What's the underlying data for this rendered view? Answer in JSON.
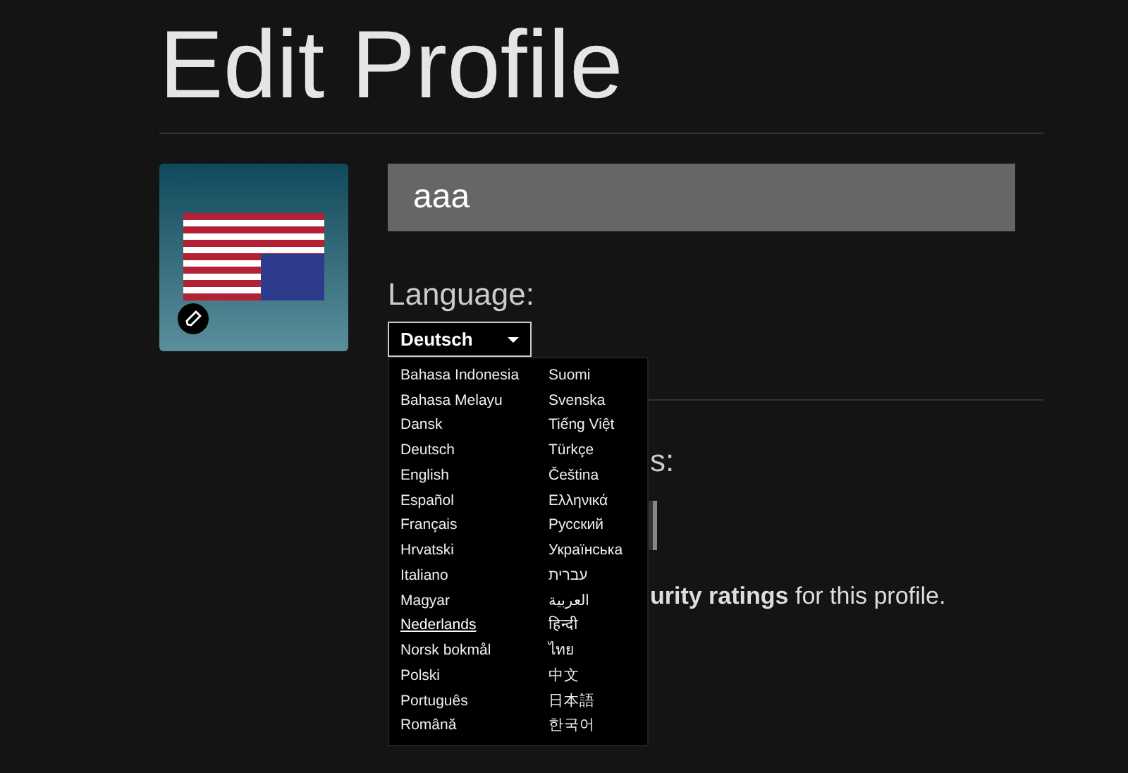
{
  "title": "Edit Profile",
  "profile": {
    "name": "aaa"
  },
  "language": {
    "label": "Language:",
    "value": "Deutsch",
    "expanded": true,
    "options": [
      {
        "label": "Bahasa Indonesia",
        "hovered": false
      },
      {
        "label": "Bahasa Melayu",
        "hovered": false
      },
      {
        "label": "Dansk",
        "hovered": false
      },
      {
        "label": "Deutsch",
        "hovered": false
      },
      {
        "label": "English",
        "hovered": false
      },
      {
        "label": "Español",
        "hovered": false
      },
      {
        "label": "Français",
        "hovered": false
      },
      {
        "label": "Hrvatski",
        "hovered": false
      },
      {
        "label": "Italiano",
        "hovered": false
      },
      {
        "label": "Magyar",
        "hovered": false
      },
      {
        "label": "Nederlands",
        "hovered": true
      },
      {
        "label": "Norsk bokmål",
        "hovered": false
      },
      {
        "label": "Polski",
        "hovered": false
      },
      {
        "label": "Português",
        "hovered": false
      },
      {
        "label": "Română",
        "hovered": false
      },
      {
        "label": "Suomi",
        "hovered": false
      },
      {
        "label": "Svenska",
        "hovered": false
      },
      {
        "label": "Tiếng Việt",
        "hovered": false
      },
      {
        "label": "Türkçe",
        "hovered": false
      },
      {
        "label": "Čeština",
        "hovered": false
      },
      {
        "label": "Ελληνικά",
        "hovered": false
      },
      {
        "label": "Русский",
        "hovered": false
      },
      {
        "label": "Українська",
        "hovered": false
      },
      {
        "label": "עברית",
        "hovered": false
      },
      {
        "label": "العربية",
        "hovered": false
      },
      {
        "label": "हिन्दी",
        "hovered": false
      },
      {
        "label": "ไทย",
        "hovered": false
      },
      {
        "label": "中文",
        "hovered": false
      },
      {
        "label": "日本語",
        "hovered": false
      },
      {
        "label": "한국어",
        "hovered": false
      }
    ]
  },
  "maturity": {
    "label": "s:",
    "description": "**urity ratings** for this profile."
  }
}
